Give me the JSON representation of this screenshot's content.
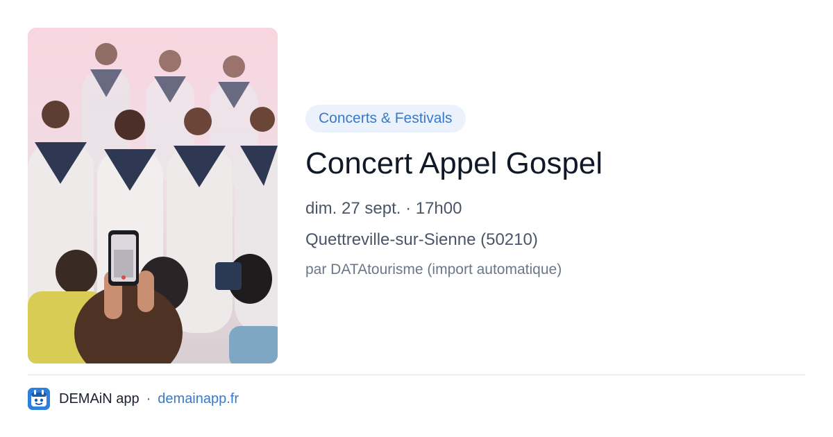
{
  "event": {
    "category": "Concerts & Festivals",
    "title": "Concert Appel Gospel",
    "date_time": "dim. 27 sept. · 17h00",
    "location": "Quettreville-sur-Sienne (50210)",
    "source": "par DATAtourisme (import automatique)",
    "photo_subject": "gospel choir in white robes performing, audience filming with phone"
  },
  "footer": {
    "app_name": "DEMAiN app",
    "separator": "·",
    "link": "demainapp.fr",
    "logo_icon": "demain-logo-icon"
  },
  "colors": {
    "accent": "#3a78c9",
    "pill_background": "#ebf2fb",
    "title": "#111827",
    "meta": "#4a5568",
    "muted": "#6b7789",
    "logo": "#2f7fdc"
  }
}
